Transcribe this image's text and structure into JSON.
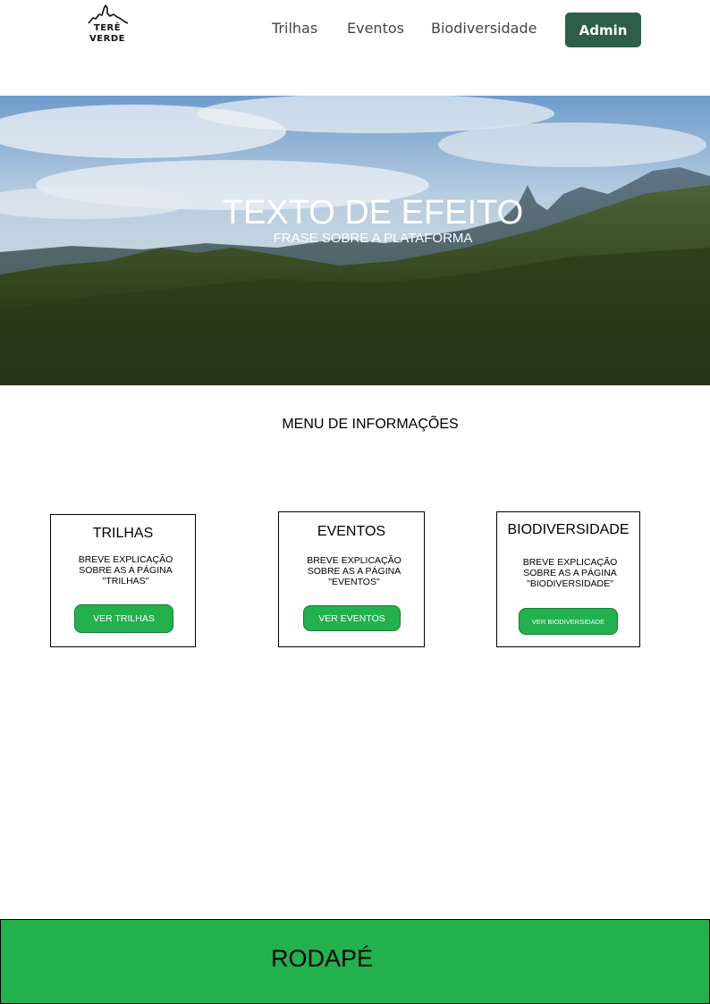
{
  "header": {
    "logo": {
      "line1": "TERÊ",
      "line2": "VERDE"
    },
    "nav": [
      {
        "label": "Trilhas"
      },
      {
        "label": "Eventos"
      },
      {
        "label": "Biodiversidade"
      }
    ],
    "admin_label": "Admin"
  },
  "hero": {
    "title": "TEXTO DE EFEITO",
    "subtitle": "FRASE SOBRE A PLATAFORMA"
  },
  "menu": {
    "title": "MENU DE INFORMAÇÕES",
    "cards": [
      {
        "title": "TRILHAS",
        "description": "BREVE EXPLICAÇÃO\nSOBRE AS A PÁGINA\n\"TRILHAS\"",
        "button": "VER TRILHAS"
      },
      {
        "title": "EVENTOS",
        "description": "BREVE EXPLICAÇÃO\nSOBRE AS A PÁGINA\n\"EVENTOS\"",
        "button": "VER EVENTOS"
      },
      {
        "title": "BIODIVERSIDADE",
        "description": "BREVE EXPLICAÇÃO\nSOBRE AS A PÁGINA\n\"BIODIVERSIDADE\"",
        "button": "VER BIODIVERSIDADE"
      }
    ]
  },
  "footer": {
    "label": "RODAPÉ"
  },
  "colors": {
    "admin_button": "#2e5e4a",
    "card_button": "#22b14c",
    "footer": "#22b14c"
  },
  "icons": {
    "logo": "mountain-logo-icon"
  }
}
